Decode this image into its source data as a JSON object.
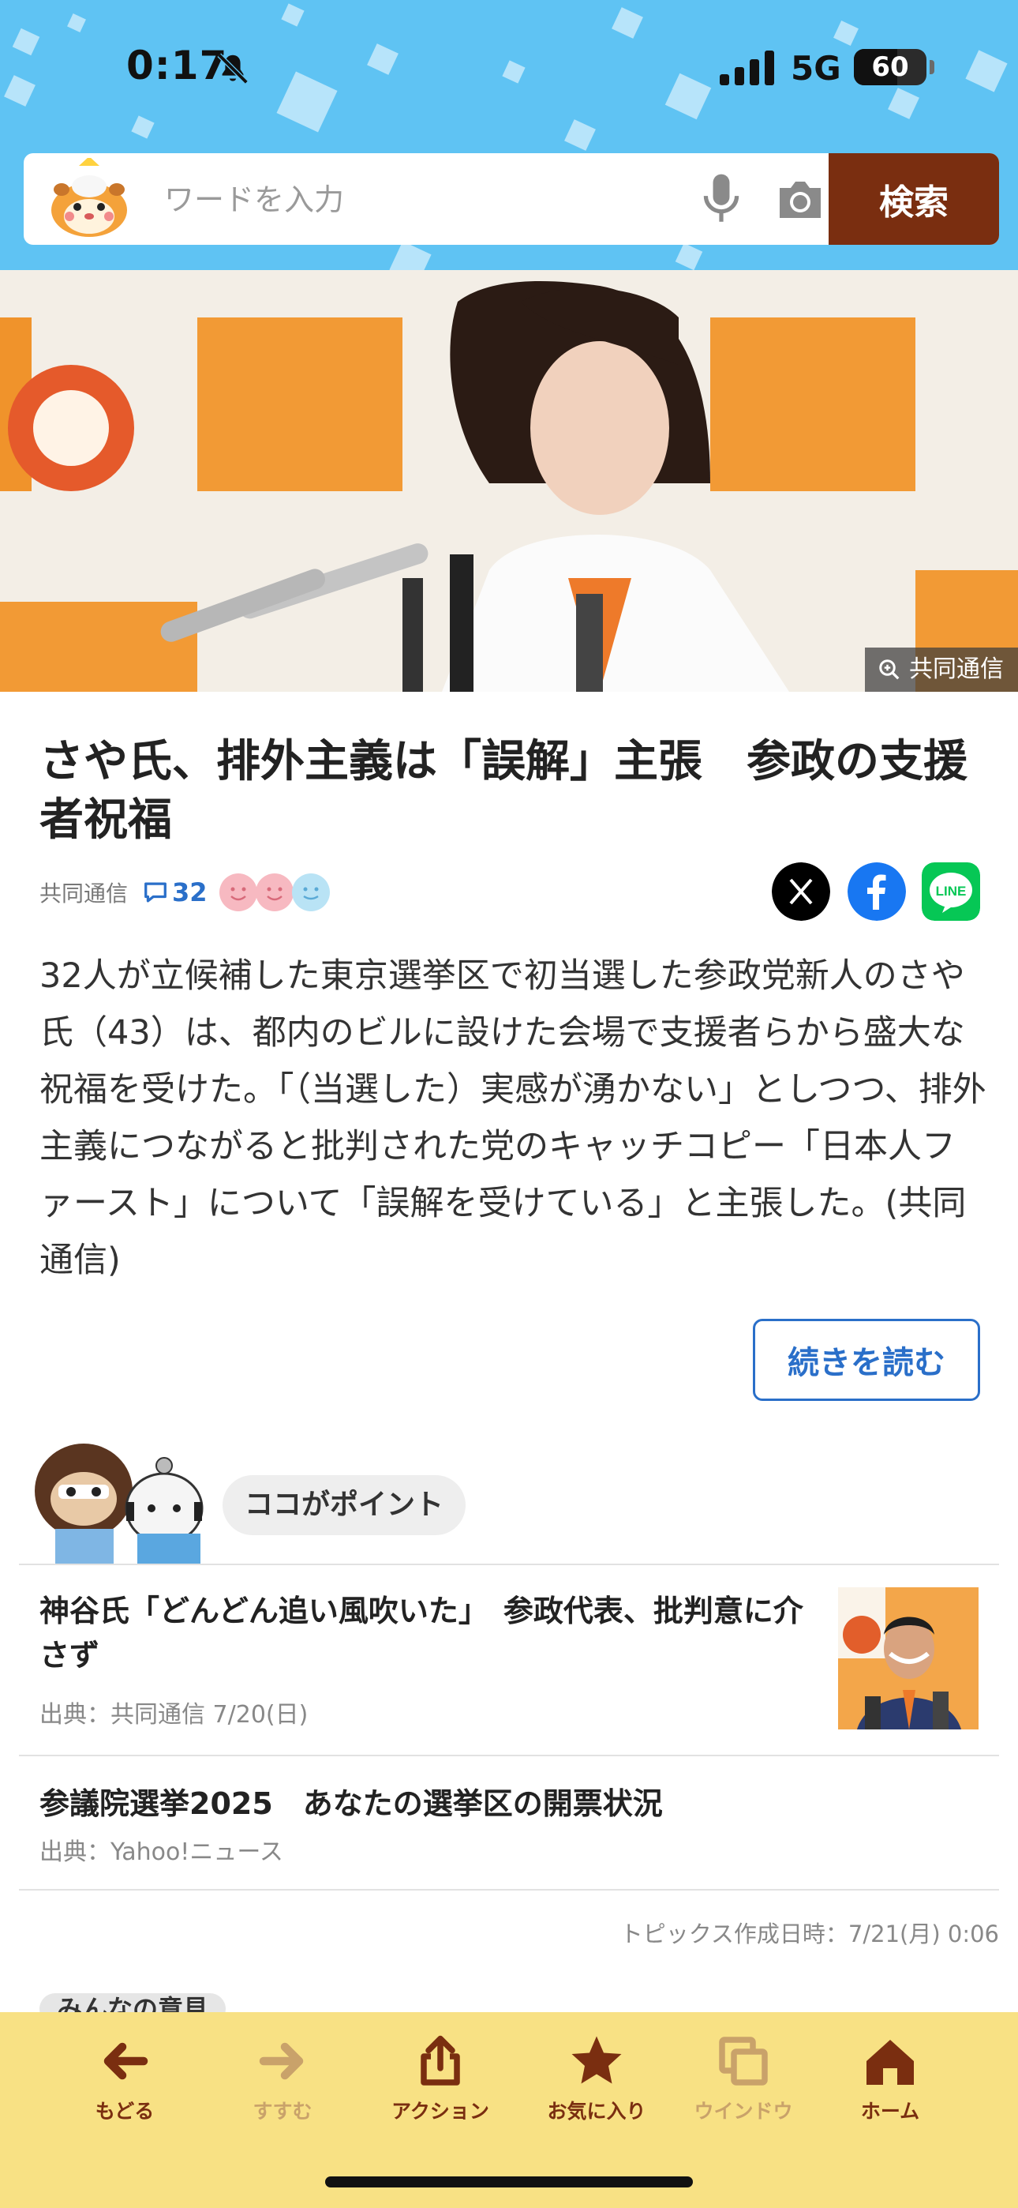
{
  "status_bar": {
    "time": "0:17",
    "network": "5G",
    "battery": "60",
    "battery_level": 0.6
  },
  "search": {
    "placeholder": "ワードを入力",
    "button_label": "検索"
  },
  "hero": {
    "photo_credit": "共同通信"
  },
  "article": {
    "title": "さや氏、排外主義は「誤解」主張　参政の支援者祝福",
    "source": "共同通信",
    "comment_count": "32",
    "body": "32人が立候補した東京選挙区で初当選した参政党新人のさや氏（43）は、都内のビルに設けた会場で支援者らから盛大な祝福を受けた。「（当選した）実感が湧かない」としつつ、排外主義につながると批判された党のキャッチコピー「日本人ファースト」について「誤解を受けている」と主張した。(共同通信)",
    "read_more_label": "続きを読む",
    "colors": {
      "accent": "#2a6fc9",
      "search_button": "#7a2e10",
      "header_bg": "#5fc3f3",
      "toolbar_bg": "#f8e184"
    }
  },
  "points": {
    "label": "ココがポイント",
    "items": [
      {
        "title": "神谷氏「どんどん追い風吹いた」　参政代表、批判意に介さず",
        "meta": "出典：共同通信 7/20(日)"
      },
      {
        "title": "参議院選挙2025　あなたの選挙区の開票状況",
        "meta": "出典：Yahoo!ニュース"
      }
    ],
    "created": "トピックス作成日時：7/21(月) 0:06"
  },
  "next_section": {
    "label": "みんなの意見"
  },
  "toolbar": {
    "items": [
      {
        "label": "もどる",
        "icon": "back-arrow-icon"
      },
      {
        "label": "すすむ",
        "icon": "forward-arrow-icon"
      },
      {
        "label": "アクション",
        "icon": "share-icon"
      },
      {
        "label": "お気に入り",
        "icon": "star-icon"
      },
      {
        "label": "ウインドウ",
        "icon": "windows-icon"
      },
      {
        "label": "ホーム",
        "icon": "home-icon"
      }
    ]
  }
}
